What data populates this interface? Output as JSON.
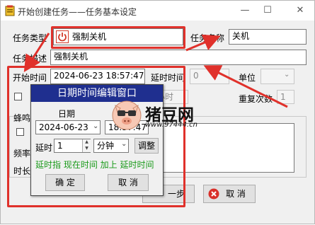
{
  "window": {
    "title": "开始创建任务——任务基本设定"
  },
  "form": {
    "task_type_label": "任务类型",
    "task_type_value": "强制关机",
    "task_name_label": "任务名称",
    "task_name_value": "关机",
    "task_desc_label": "任务描述",
    "task_desc_value": "强制关机",
    "start_time_label": "开始时间",
    "start_time_value": "2024-06-23 18:57:47",
    "delay_time_label": "延时时间",
    "delay_time_value": "0",
    "unit_label": "单位",
    "repeat_partial": "小时",
    "repeat_count_label": "重复次数",
    "repeat_count_value": "1",
    "beep_partial": "蜂鸣",
    "freq_partial": "频率",
    "duration_partial": "时长"
  },
  "buttons": {
    "back_partial": "一步",
    "cancel_label": "取 消"
  },
  "dialog": {
    "title": "日期时间编辑窗口",
    "date_label": "日期",
    "date_value": "2024-06-23",
    "time_value": "18:57:47",
    "delay_label": "延时",
    "delay_value": "1",
    "unit_value": "分钟",
    "adjust_label": "调整",
    "hint": "延时指 现在时间 加上 延时时间",
    "ok_label": "确 定",
    "cancel_label": "取 消"
  },
  "watermark": {
    "text": "猪豆网",
    "url": "www.97444.cn"
  },
  "colors": {
    "highlight": "#e0312b",
    "dialog_title_bg": "#1f2f8f",
    "hint_text": "#1a9a1a"
  }
}
